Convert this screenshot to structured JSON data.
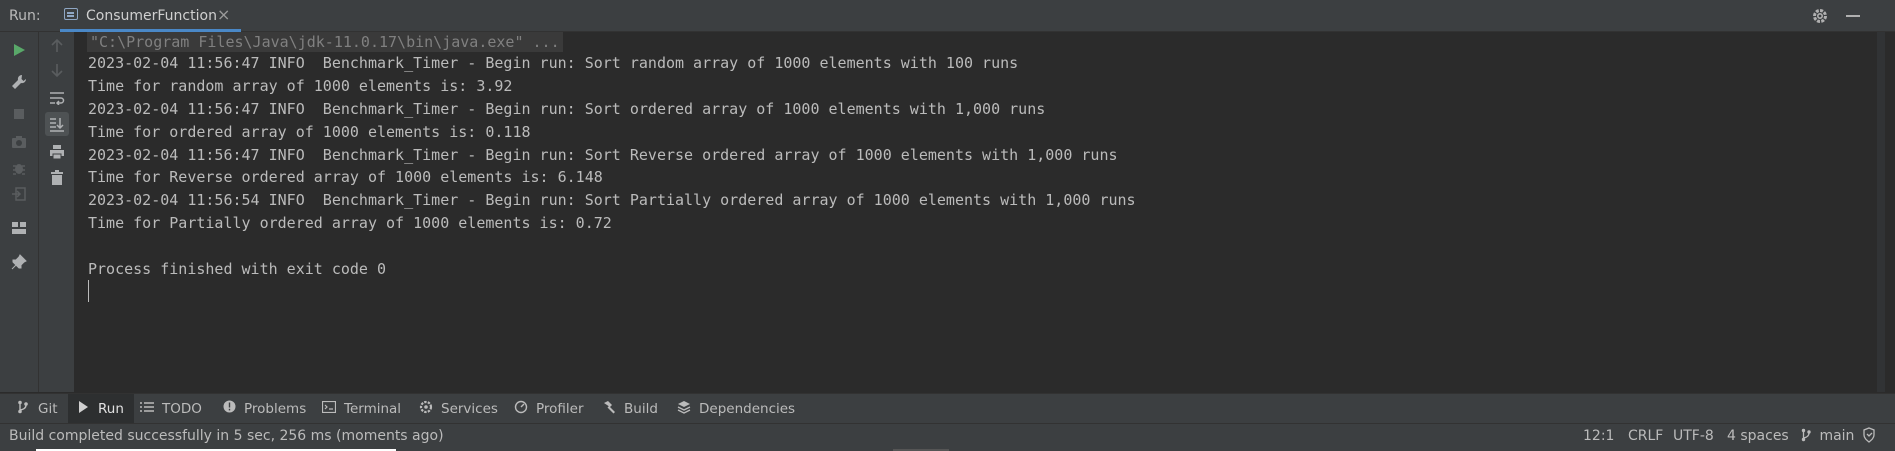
{
  "run_header": {
    "label": "Run:",
    "tab_title": "ConsumerFunction",
    "close_glyph": "×"
  },
  "left_toolbar": {
    "icons": [
      "run-icon",
      "wrench-icon",
      "stop-icon",
      "camera-icon",
      "debug-icon",
      "exit-icon",
      "layout-icon",
      "pin-icon"
    ]
  },
  "second_toolbar": {
    "icons": [
      "up-arrow-icon",
      "down-arrow-icon",
      "soft-wrap-icon",
      "scroll-to-end-icon",
      "print-icon",
      "trash-icon"
    ]
  },
  "console": {
    "command": "\"C:\\Program Files\\Java\\jdk-11.0.17\\bin\\java.exe\" ...",
    "lines": [
      "2023-02-04 11:56:47 INFO  Benchmark_Timer - Begin run: Sort random array of 1000 elements with 100 runs",
      "Time for random array of 1000 elements is: 3.92",
      "2023-02-04 11:56:47 INFO  Benchmark_Timer - Begin run: Sort ordered array of 1000 elements with 1,000 runs",
      "Time for ordered array of 1000 elements is: 0.118",
      "2023-02-04 11:56:47 INFO  Benchmark_Timer - Begin run: Sort Reverse ordered array of 1000 elements with 1,000 runs",
      "Time for Reverse ordered array of 1000 elements is: 6.148",
      "2023-02-04 11:56:54 INFO  Benchmark_Timer - Begin run: Sort Partially ordered array of 1000 elements with 1,000 runs",
      "Time for Partially ordered array of 1000 elements is: 0.72"
    ],
    "exit_message": "Process finished with exit code 0"
  },
  "bottom_bar": {
    "items": [
      {
        "label": "Git",
        "icon": "git-branch-icon"
      },
      {
        "label": "Run",
        "icon": "run-icon"
      },
      {
        "label": "TODO",
        "icon": "list-icon"
      },
      {
        "label": "Problems",
        "icon": "problems-icon"
      },
      {
        "label": "Terminal",
        "icon": "terminal-icon"
      },
      {
        "label": "Services",
        "icon": "services-icon"
      },
      {
        "label": "Profiler",
        "icon": "profiler-icon"
      },
      {
        "label": "Build",
        "icon": "hammer-icon"
      },
      {
        "label": "Dependencies",
        "icon": "dependencies-icon"
      }
    ],
    "active": "Run"
  },
  "status_bar": {
    "message": "Build completed successfully in 5 sec, 256 ms (moments ago)",
    "position": "12:1",
    "line_separator": "CRLF",
    "encoding": "UTF-8",
    "indent": "4 spaces",
    "branch": "main"
  },
  "colors": {
    "background": "#2b2b2b",
    "panel": "#3c3f41",
    "accent": "#4a88c7",
    "run_green": "#59a869",
    "text": "#bbbbbb"
  }
}
